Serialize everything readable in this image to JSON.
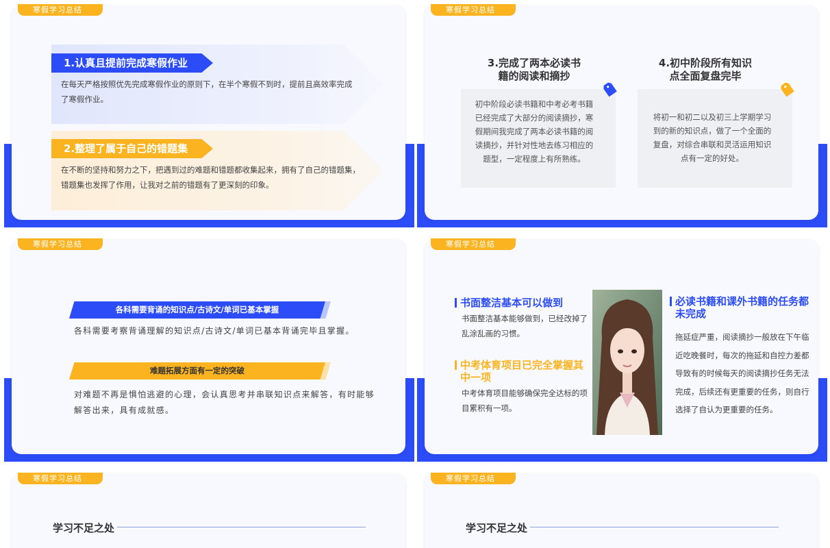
{
  "tag_text": "寒假学习总结",
  "slide1": {
    "item1_title": "1.认真且提前完成寒假作业",
    "item1_text": "在每天严格按照优先完成寒假作业的原则下，在半个寒假不到时，提前且高效率完成了寒假作业。",
    "item2_title": "2.整理了属于自己的错题集",
    "item2_text": "在不断的坚持和努力之下，把遇到过的难题和错题都收集起来，拥有了自己的错题集，错题集也发挥了作用，让我对之前的错题有了更深刻的印象。"
  },
  "slide2": {
    "col1_title": "3.完成了两本必读书籍的阅读和摘抄",
    "col1_text": "初中阶段必读书籍和中考必考书籍已经完成了大部分的阅读摘抄，寒假期间我完成了两本必读书籍的阅读摘抄，并针对性地去练习相应的题型，一定程度上有所熟练。",
    "col2_title": "4.初中阶段所有知识点全面复盘完毕",
    "col2_text": "将初一和初二以及初三上学期学习到的新的知识点，做了一个全面的复盘，对综合串联和灵活运用知识点有一定的好处。"
  },
  "slide3": {
    "band1": "各科需要背诵的知识点/古诗文/单词已基本掌握",
    "text1": "各科需要考察背诵理解的知识点/古诗文/单词已基本背诵完毕且掌握。",
    "band2": "难题拓展方面有一定的突破",
    "text2": "对难题不再是惧怕逃避的心理，会认真思考并串联知识点来解答，有时能够解答出来，具有成就感。"
  },
  "slide4": {
    "left1_title": "书面整洁基本可以做到",
    "left1_text": "书面整洁基本能够做到，已经改掉了乱涂乱画的习惯。",
    "left2_title": "中考体育项目已完全掌握其中一项",
    "left2_text": "中考体育项目能够确保完全达标的项目累积有一项。",
    "right_title": "必读书籍和课外书籍的任务都未完成",
    "right_text": "拖延症严重，阅读摘抄一般放在下午临近吃晚餐时，每次的拖延和自控力差都导致有的时候每天的阅读摘抄任务无法完成，后续还有更重要的任务，则自行选择了自认为更重要的任务。"
  },
  "slide5": {
    "section_title": "学习不足之处"
  },
  "slide6": {
    "section_title": "学习不足之处"
  },
  "colors": {
    "primary": "#2b4cf6",
    "accent": "#fbb420"
  }
}
